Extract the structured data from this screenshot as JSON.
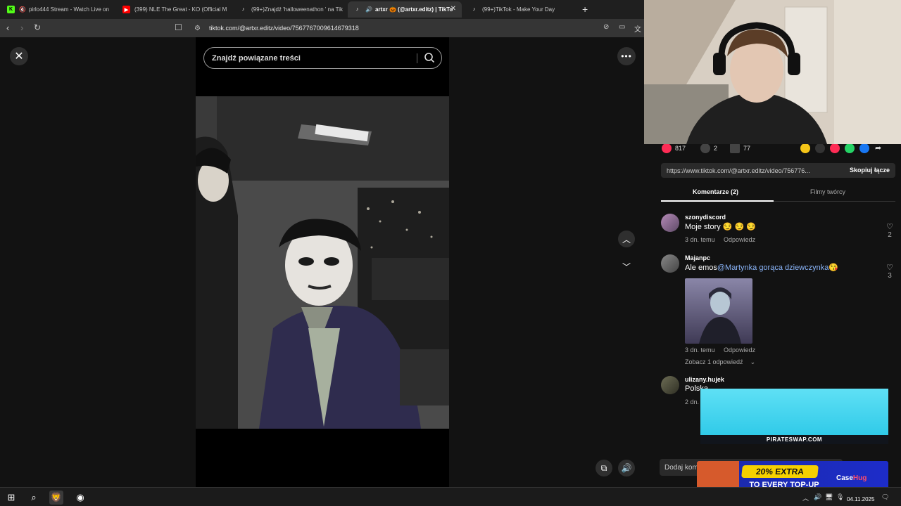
{
  "browser": {
    "tabs": [
      {
        "label": "pirlo444 Stream - Watch Live on",
        "favicon": "kick-icon",
        "active": false
      },
      {
        "label": "(399) NLE The Great - KO (Official M",
        "favicon": "youtube-icon",
        "active": false
      },
      {
        "label": "(99+)Znajdź 'halloweenathon ' na Tik",
        "favicon": "tiktok-icon",
        "active": false
      },
      {
        "label": "artxr 🎃 (@artxr.editz) | TikTo",
        "favicon": "tiktok-icon",
        "active": true
      },
      {
        "label": "(99+)TikTok - Make Your Day",
        "favicon": "tiktok-icon",
        "active": false
      }
    ],
    "url": "tiktok.com/@artxr.editz/video/7567767009614679318"
  },
  "page": {
    "search_placeholder": "Znajdź powiązane treści",
    "stats": {
      "likes": "817",
      "comments": "2",
      "saves": "77"
    },
    "share_url": "https://www.tiktok.com/@artxr.editz/video/756776...",
    "copy_label": "Skopiuj łącze",
    "tabs": [
      "Komentarze (2)",
      "Filmy twórcy"
    ],
    "comments": [
      {
        "user": "szonydiscord",
        "text": "Moje story 😏 😏 😏",
        "time": "3 dn. temu",
        "reply": "Odpowiedz",
        "likes": "2"
      },
      {
        "user": "Majanpc",
        "text_before": "Ale emos",
        "mention": "@Martynka gorąca dziewczynka",
        "emoji": "😘",
        "time": "3 dn. temu",
        "reply": "Odpowiedz",
        "likes": "3",
        "view_replies": "Zobacz 1 odpowiedź"
      },
      {
        "user": "ulizany.hujek",
        "text": "Polska...",
        "time": "2 dn."
      }
    ],
    "add_comment_placeholder": "Dodaj kom"
  },
  "ads": {
    "top_brand": "PIRATESWAP.COM",
    "bottom_pill": "20% EXTRA",
    "bottom_sub": "TO EVERY TOP-UP",
    "bottom_brand_a": "Case",
    "bottom_brand_b": "Hug"
  },
  "taskbar": {
    "date": "04.11.2025"
  },
  "colors": {
    "tiktok_red": "#fe2c55",
    "mention_blue": "#8ab4f8",
    "ad_cyan": "#27c6e6",
    "ad_blue": "#1d2cc9",
    "ad_yellow": "#f5d000"
  }
}
